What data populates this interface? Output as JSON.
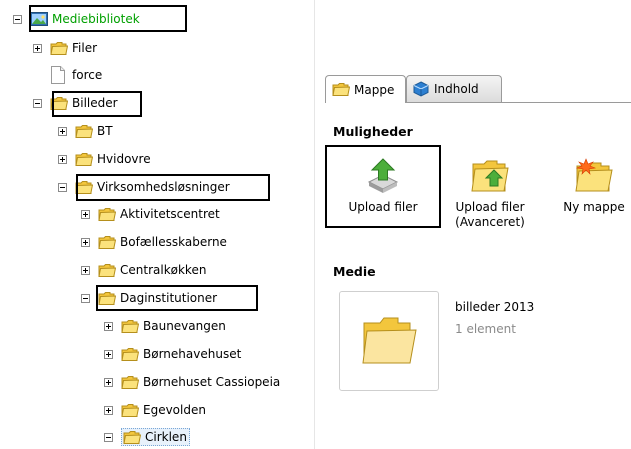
{
  "tree": {
    "root": "Mediebibliotek",
    "items": [
      {
        "label": "Filer"
      },
      {
        "label": "force"
      },
      {
        "label": "Billeder"
      },
      {
        "label": "BT"
      },
      {
        "label": "Hvidovre"
      },
      {
        "label": "Virksomhedsløsninger"
      },
      {
        "label": "Aktivitetscentret"
      },
      {
        "label": "Bofællesskaberne"
      },
      {
        "label": "Centralkøkken"
      },
      {
        "label": "Daginstitutioner"
      },
      {
        "label": "Baunevangen"
      },
      {
        "label": "Børnehavehuset"
      },
      {
        "label": "Børnehuset Cassiopeia"
      },
      {
        "label": "Egevolden"
      },
      {
        "label": "Cirklen"
      }
    ]
  },
  "tabs": [
    {
      "label": "Mappe"
    },
    {
      "label": "Indhold"
    }
  ],
  "muligheder": {
    "heading": "Muligheder",
    "actions": [
      {
        "label": "Upload filer"
      },
      {
        "label_line1": "Upload filer",
        "label_line2": "(Avanceret)"
      },
      {
        "label": "Ny mappe"
      }
    ]
  },
  "medie": {
    "heading": "Medie",
    "item": {
      "name": "billeder 2013",
      "count": "1 element"
    }
  },
  "colors": {
    "root_label": "#00a000",
    "folder_fill": "#f7d85b",
    "folder_edge": "#c9a52a",
    "tab_cube": "#2c7fd1",
    "upload_arrow": "#4cae3b"
  }
}
